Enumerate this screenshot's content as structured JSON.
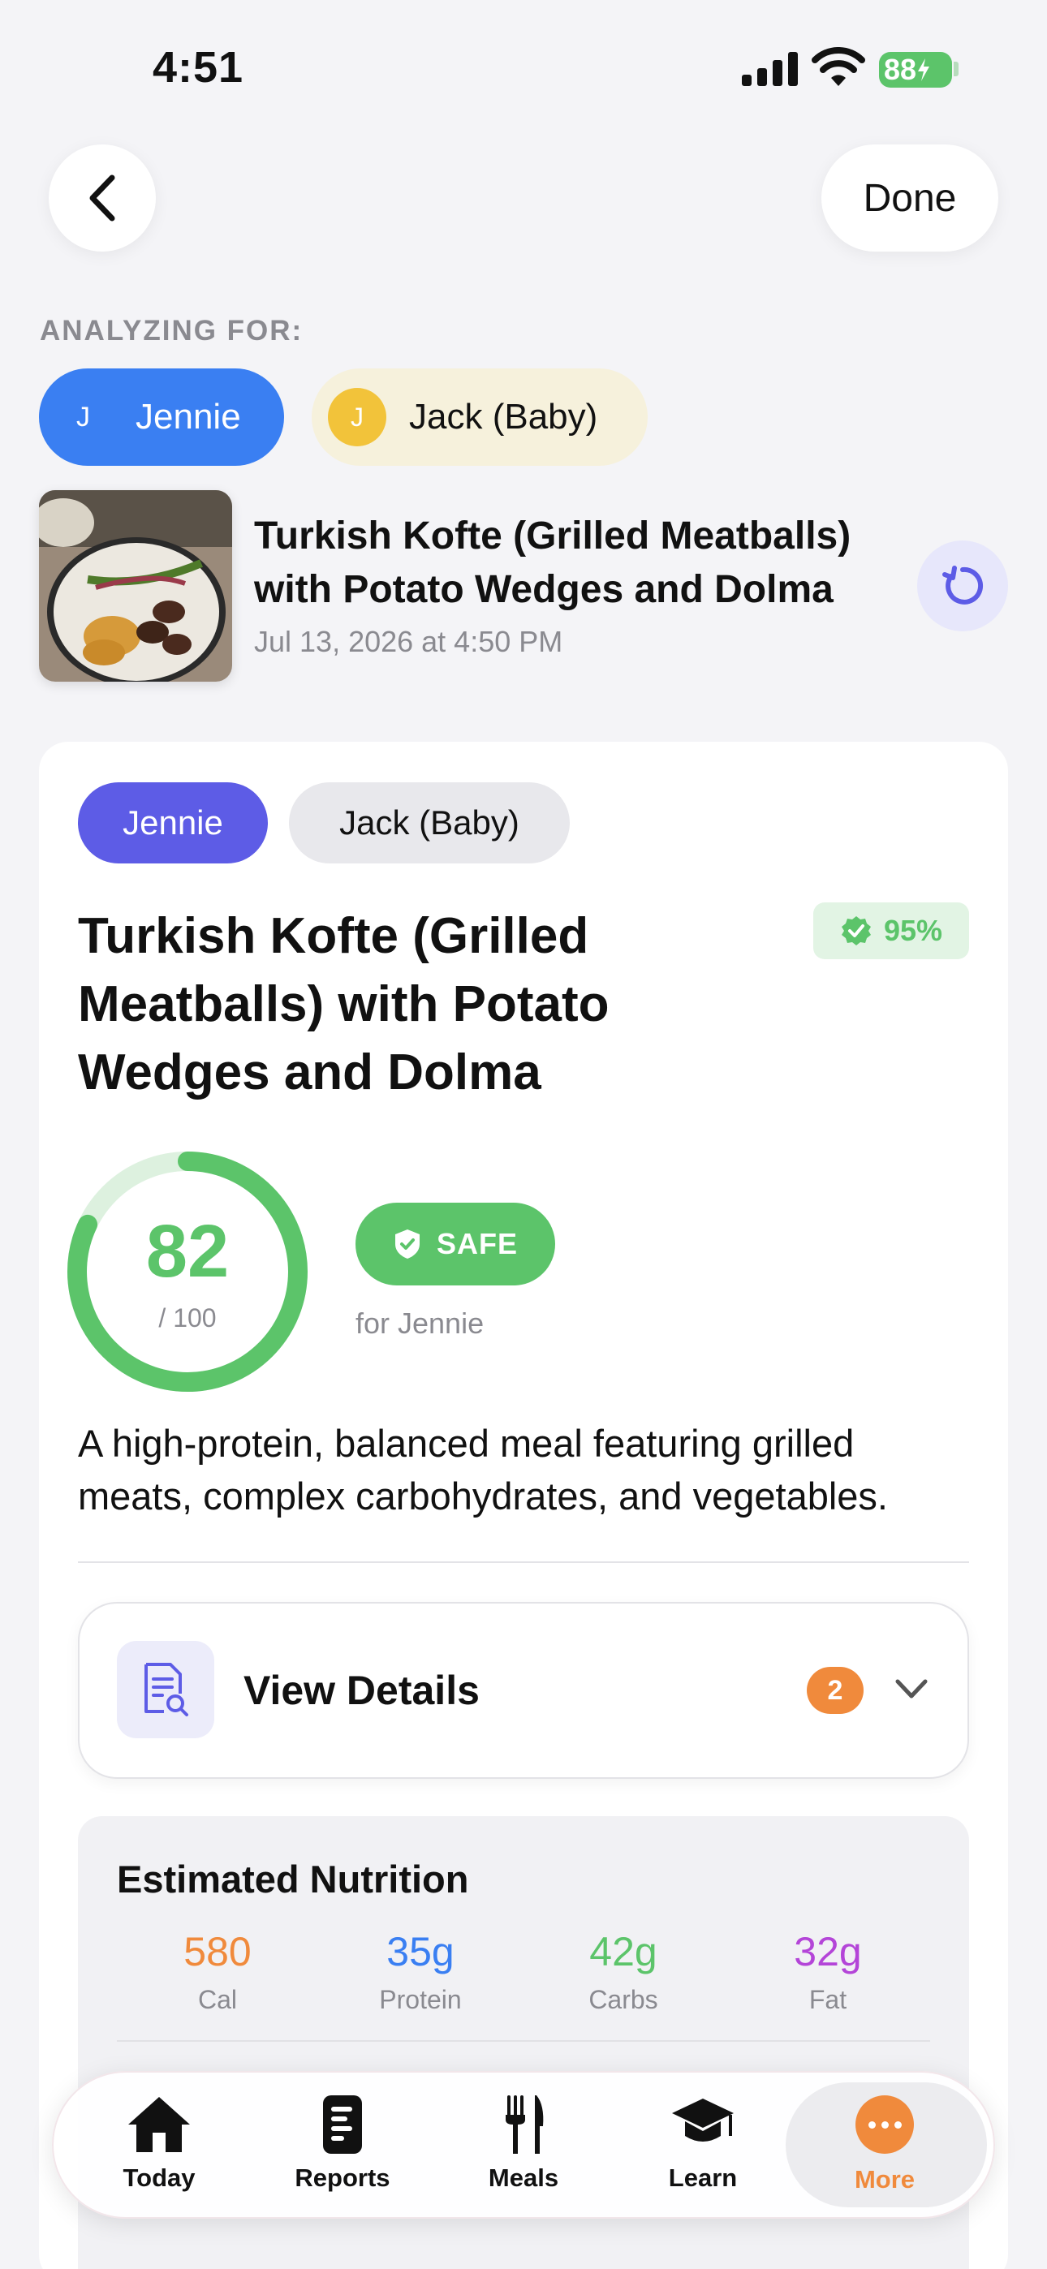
{
  "status_bar": {
    "time": "4:51",
    "battery": "88"
  },
  "nav": {
    "done_label": "Done"
  },
  "analyzing": {
    "label": "ANALYZING FOR:",
    "people": [
      {
        "initial": "J",
        "name": "Jennie",
        "selected": true,
        "color": "#3a7ff2"
      },
      {
        "initial": "J",
        "name": "Jack (Baby)",
        "selected": false,
        "color": "#f2c33a"
      }
    ]
  },
  "meal_header": {
    "title": "Turkish Kofte (Grilled Meatballs) with Potato Wedges and Dolma",
    "date": "Jul 13, 2026 at 4:50 PM"
  },
  "card": {
    "tabs": [
      "Jennie",
      "Jack (Baby)"
    ],
    "confidence": "95%",
    "title": "Turkish Kofte (Grilled Meatballs) with Potato Wedges and Dolma",
    "score": {
      "value": "82",
      "max": "/ 100",
      "fraction": 0.82
    },
    "safety": {
      "label": "SAFE",
      "for": "for Jennie"
    },
    "summary": "A high-protein, balanced meal featuring grilled meats, complex carbohydrates, and vegetables.",
    "details": {
      "label": "View Details",
      "count": "2"
    },
    "nutrition": {
      "title": "Estimated Nutrition",
      "items": [
        {
          "value": "580",
          "label": "Cal",
          "color": "#f08a3c"
        },
        {
          "value": "35g",
          "label": "Protein",
          "color": "#3a7ff2"
        },
        {
          "value": "42g",
          "label": "Carbs",
          "color": "#5cc46a"
        },
        {
          "value": "32g",
          "label": "Fat",
          "color": "#b445d8"
        }
      ]
    }
  },
  "tabbar": {
    "items": [
      {
        "label": "Today",
        "icon": "home-icon"
      },
      {
        "label": "Reports",
        "icon": "document-icon"
      },
      {
        "label": "Meals",
        "icon": "fork-knife-icon"
      },
      {
        "label": "Learn",
        "icon": "graduation-cap-icon"
      },
      {
        "label": "More",
        "icon": "more-icon",
        "active": true
      }
    ]
  },
  "colors": {
    "accent_purple": "#5d5ce6",
    "safe_green": "#5cc46a",
    "badge_orange": "#f08a3c"
  }
}
